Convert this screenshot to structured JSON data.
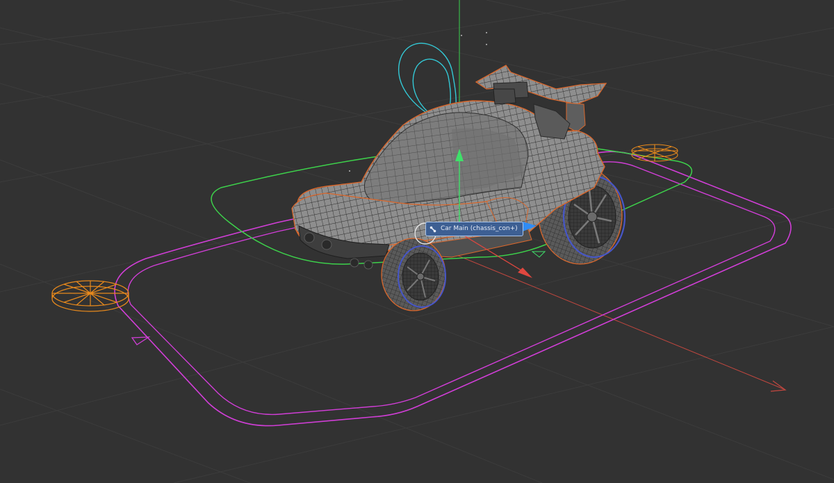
{
  "viewport": {
    "name": "3D viewport",
    "background": "#323232",
    "grid_color": "#3c3c3c"
  },
  "scene": {
    "object": "car",
    "colors": {
      "body_fill": "#8f8f8f",
      "body_wire": "#2a2a2a",
      "selection_outline": "#d9672c",
      "root_control": "#d23ed8",
      "chassis_control": "#3dd24b",
      "rotate_ring": "#33c9d6",
      "wheel_control": "#e98a1c",
      "front_wheel_ring": "#4656c8",
      "axis_x": "#e0473f",
      "axis_y": "#3fe06a",
      "axis_z": "#2f8cf5"
    },
    "icons": [
      "rotate-ring-icon",
      "move-gizmo-icon",
      "wheel-control-icon",
      "direction-arrow-icon"
    ]
  },
  "tooltip": {
    "label": "Car Main (chassis_con+)",
    "icon": "bone-icon",
    "background": "#3d5f93"
  }
}
